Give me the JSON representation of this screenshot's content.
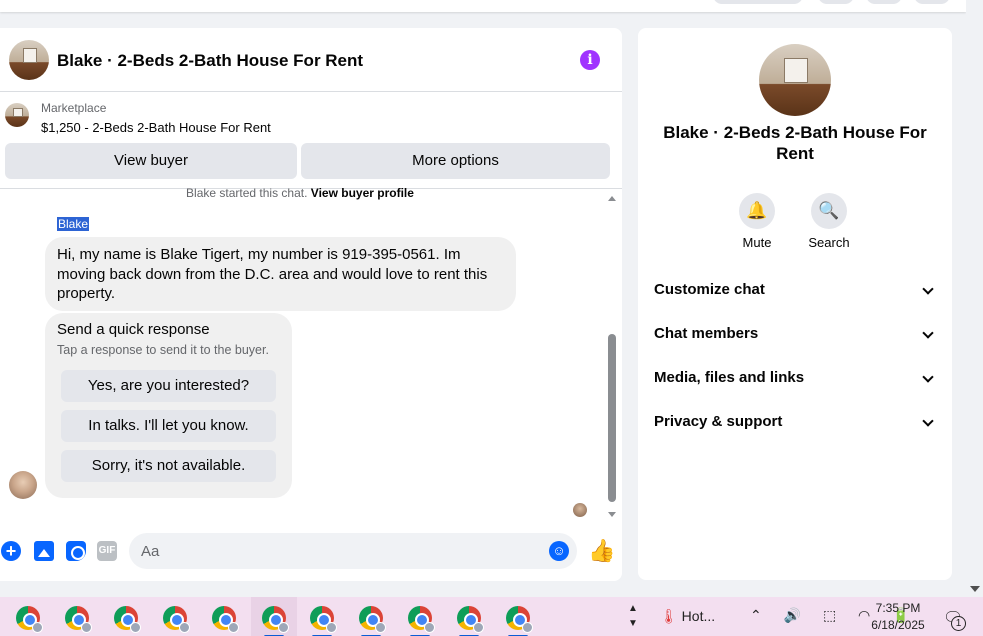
{
  "header": {
    "title": "Blake · 2-Beds 2-Bath House For Rent",
    "info_icon": "info-icon",
    "info_glyph": "i",
    "accent_color": "#a033ff"
  },
  "listing": {
    "label": "Marketplace",
    "title": "$1,250 - 2-Beds 2-Bath House For Rent",
    "view_buyer": "View buyer",
    "more_options": "More options"
  },
  "thread": {
    "started_prefix": "Blake started this chat. ",
    "started_link": "View buyer profile",
    "sender": "Blake",
    "message": "Hi, my name is Blake Tigert, my number is 919-395-0561. Im moving back down from the D.C. area and would love to rent this property.",
    "quick_title": "Send a quick response",
    "quick_subtitle": "Tap a response to send it to the buyer.",
    "quick_replies": [
      "Yes, are you interested?",
      "In talks. I'll let you know.",
      "Sorry, it's not available."
    ]
  },
  "composer": {
    "placeholder": "Aa",
    "gif_label": "GIF",
    "plus_glyph": "+",
    "emoji_glyph": "☺",
    "like_glyph": "👍",
    "accent_color": "#0866ff"
  },
  "details": {
    "title": "Blake · 2-Beds 2-Bath House For Rent",
    "mute_label": "Mute",
    "search_label": "Search",
    "mute_glyph": "🔔",
    "search_glyph": "🔍",
    "sections": [
      "Customize chat",
      "Chat members",
      "Media, files and links",
      "Privacy & support"
    ]
  },
  "taskbar": {
    "weather": "Hot...",
    "weather_glyph": "🌡",
    "tray_up_glyph": "^",
    "tray_glyphs": "⌃ 🔊 ⬚ ◠ 🔋",
    "time": "7:35 PM",
    "date": "6/18/2025",
    "notif_glyph": "🗨",
    "notifications": "1",
    "up_arrow": "▲",
    "down_arrow": "▼"
  }
}
